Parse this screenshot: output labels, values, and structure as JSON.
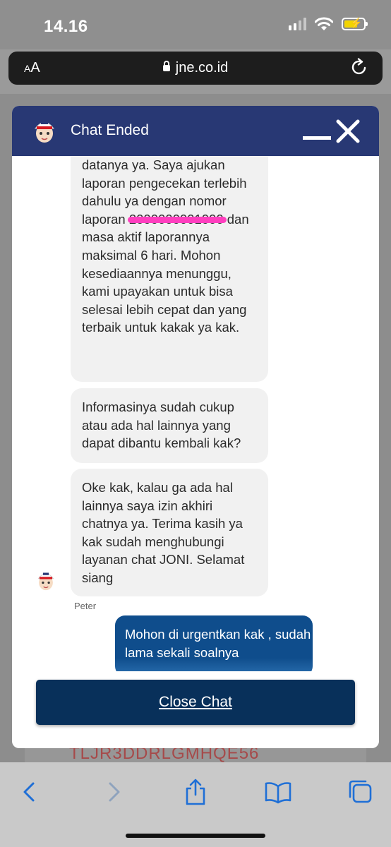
{
  "status_bar": {
    "time": "14.16"
  },
  "browser": {
    "text_size_label_small": "A",
    "text_size_label_large": "A",
    "url": "jne.co.id"
  },
  "background_page": {
    "tracking_fragment": "TLJR3DDRLGMHQE56"
  },
  "chat": {
    "title": "Chat Ended",
    "messages": {
      "agent_1_before": "datanya ya. Saya ajukan laporan pengecekan terlebih dahulu ya dengan nomor laporan ",
      "agent_1_redacted": "2000000001000",
      "agent_1_after": " dan masa aktif laporannya maksimal 6 hari. Mohon kesediaannya menunggu, kami upayakan untuk bisa selesai lebih cepat dan yang terbaik untuk kakak ya kak.",
      "agent_2": "Informasinya sudah cukup atau ada hal lainnya yang dapat dibantu kembali kak?",
      "agent_3": "Oke kak, kalau ga ada hal lainnya saya izin akhiri chatnya ya. Terima kasih ya kak sudah menghubungi layanan chat JONI. Selamat siang",
      "agent_name": "Peter",
      "user_1": "Mohon di urgentkan kak , sudah lama sekali soalnya"
    },
    "close_button_label": "Close Chat"
  },
  "icons": {
    "signal": "cellular-signal-icon",
    "wifi": "wifi-icon",
    "battery": "battery-charging-icon",
    "lock": "lock-icon",
    "reload": "reload-icon",
    "back": "chevron-left-icon",
    "forward": "chevron-right-icon",
    "share": "share-icon",
    "bookmarks": "book-icon",
    "tabs": "tabs-icon"
  },
  "colors": {
    "header": "#283874",
    "user_bubble": "#0f4d8c",
    "close_button": "#08305a",
    "agent_bubble": "#f1f1f1",
    "redaction": "#ff3fbf",
    "battery": "#f2d400"
  }
}
